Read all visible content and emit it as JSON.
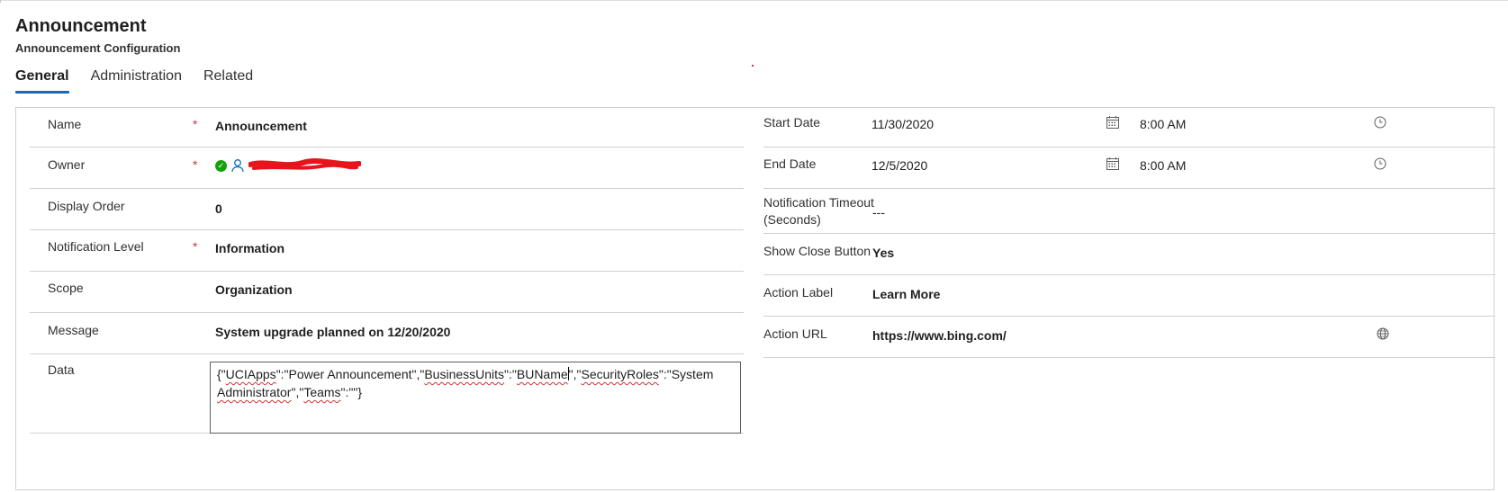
{
  "header": {
    "title": "Announcement",
    "subtitle": "Announcement Configuration"
  },
  "tabs": [
    {
      "label": "General",
      "active": true
    },
    {
      "label": "Administration",
      "active": false
    },
    {
      "label": "Related",
      "active": false
    }
  ],
  "left_fields": {
    "name": {
      "label": "Name",
      "required": "*",
      "value": "Announcement"
    },
    "owner": {
      "label": "Owner",
      "required": "*"
    },
    "display_order": {
      "label": "Display Order",
      "value": "0"
    },
    "notification_level": {
      "label": "Notification Level",
      "required": "*",
      "value": "Information"
    },
    "scope": {
      "label": "Scope",
      "value": "Organization"
    },
    "message": {
      "label": "Message",
      "value": "System upgrade planned on 12/20/2020"
    },
    "data": {
      "label": "Data",
      "parts": [
        "{\"",
        "UCIApps",
        "\":\"Power Announcement\",\"",
        "BusinessUnits",
        "\":\"",
        "BUName",
        "\",\"",
        "SecurityRoles",
        "\":\"System ",
        "Administrator",
        "\",\"",
        "Teams",
        "\":\"\"}"
      ]
    }
  },
  "right_fields": {
    "start_date": {
      "label": "Start Date",
      "date": "11/30/2020",
      "time": "8:00 AM"
    },
    "end_date": {
      "label": "End Date",
      "date": "12/5/2020",
      "time": "8:00 AM"
    },
    "notification_timeout": {
      "label_line1": "Notification Timeout",
      "label_line2": "(Seconds)",
      "value": "---"
    },
    "show_close_button": {
      "label": "Show Close Button",
      "value": "Yes"
    },
    "action_label": {
      "label": "Action Label",
      "value": "Learn More"
    },
    "action_url": {
      "label": "Action URL",
      "value": "https://www.bing.com/"
    }
  },
  "colors": {
    "accent": "#0f6cbd",
    "required": "#d13438",
    "status_ok": "#13a10e"
  },
  "icons": {
    "calendar": "calendar-icon",
    "clock": "clock-icon",
    "globe": "globe-icon",
    "person": "person-icon",
    "check": "presence-available-icon"
  }
}
